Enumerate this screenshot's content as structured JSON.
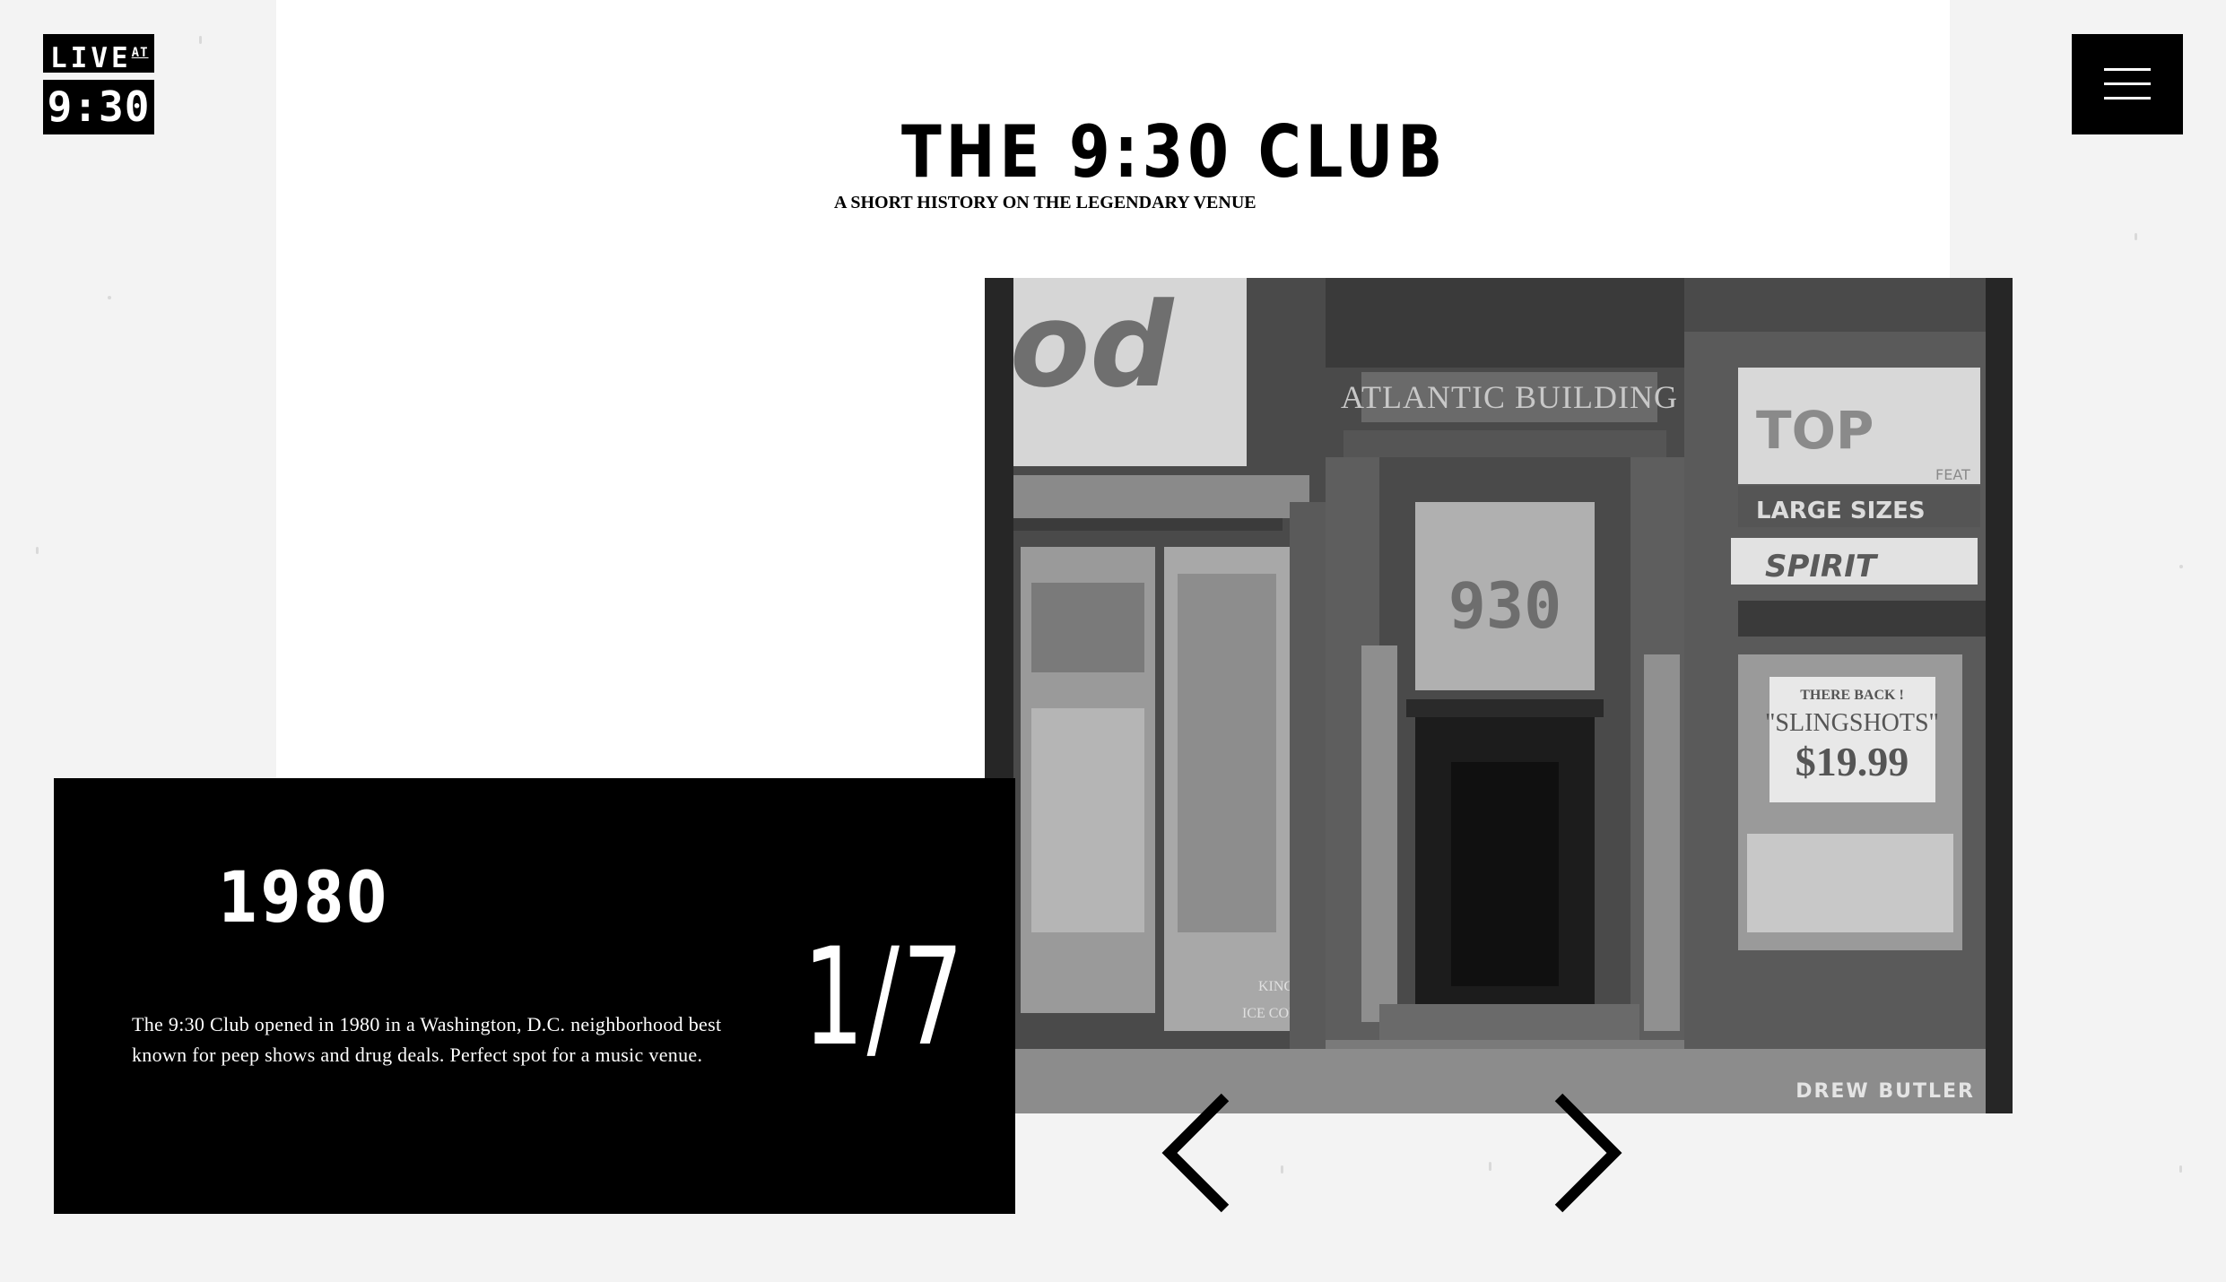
{
  "logo": {
    "line1": "LIVE",
    "line1_sup": "AT",
    "line2": "9:30"
  },
  "header": {
    "title": "THE 9:30 CLUB",
    "subtitle": "A SHORT HISTORY ON THE LEGENDARY VENUE"
  },
  "menu": {
    "icon": "hamburger-menu-icon"
  },
  "slide": {
    "year": "1980",
    "description": "The 9:30 Club opened in 1980 in a Washington, D.C. neighborhood best known for peep shows and drug deals. Perfect spot for a music venue.",
    "counter": "1/7",
    "photo_credit": "DREW BUTLER",
    "photo_signs": {
      "awning": "od",
      "building": "ATLANTIC BUILDING",
      "door_sign": "930",
      "store": "TOP",
      "store_feat": "FEAT",
      "large_sizes": "LARGE SIZES",
      "spirit": "SPIRIT",
      "ad_line1": "THERE BACK !",
      "ad_line2": "\"SLINGSHOTS\"",
      "ad_price": "$19.99",
      "king_cobra": "KING COBRA",
      "ice_cold": "ICE COLD"
    }
  },
  "navigation": {
    "prev_icon": "chevron-left-icon",
    "next_icon": "chevron-right-icon"
  },
  "colors": {
    "background": "#f3f3f3",
    "panel": "#ffffff",
    "accent": "#000000",
    "text_light": "#ffffff"
  }
}
